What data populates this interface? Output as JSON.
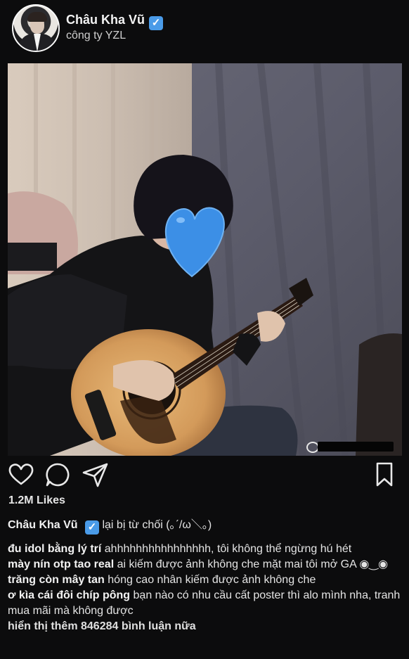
{
  "post": {
    "username": "Châu Kha Vũ",
    "verified_mark": "✓",
    "subtitle": "công ty YZL",
    "likes": "1.2M Likes",
    "caption_user": "Châu Kha Vũ",
    "caption_text": "lại bị từ chối (｡ˊ/ω＼｡)"
  },
  "icons": {
    "like": "heart-icon",
    "comment": "comment-icon",
    "share": "send-icon",
    "save": "bookmark-icon"
  },
  "comments": [
    {
      "user": "đu idol bằng lý trí",
      "text": "ahhhhhhhhhhhhhhhh, tôi không thể ngừng hú hét"
    },
    {
      "user": "mày nín otp tao real",
      "text": "ai kiếm được ảnh không che mặt mai tôi mở GA ◉‿◉"
    },
    {
      "user": "trăng còn mây tan",
      "text": "hóng cao nhân kiếm được ảnh không che"
    },
    {
      "user": "ơ kìa cái đôi chíp pông",
      "text": "bạn nào có nhu cầu cất poster thì alo mình nha, tranh mua mãi mà không được"
    }
  ],
  "more_comments": "hiển thị thêm 846284 bình luận nữa",
  "colors": {
    "background": "#0c0c0d",
    "verified": "#4a9be8",
    "heart_sticker": "#3c8fe6"
  }
}
